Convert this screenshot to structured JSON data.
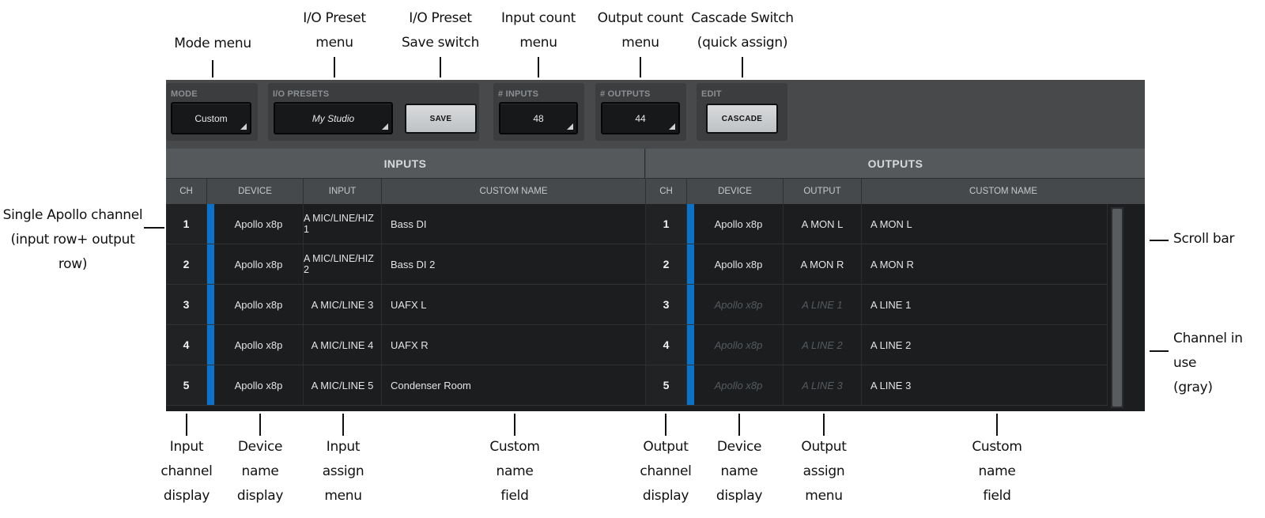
{
  "controls": {
    "mode": {
      "label": "MODE",
      "value": "Custom"
    },
    "io_presets": {
      "label": "I/O PRESETS",
      "value": "My Studio",
      "save_label": "SAVE"
    },
    "inputs": {
      "label": "# INPUTS",
      "value": "48"
    },
    "outputs": {
      "label": "# OUTPUTS",
      "value": "44"
    },
    "edit": {
      "label": "EDIT",
      "cascade_label": "CASCADE"
    }
  },
  "sections": {
    "inputs": "INPUTS",
    "outputs": "OUTPUTS"
  },
  "columns": {
    "inputs": [
      "CH",
      "DEVICE",
      "INPUT",
      "CUSTOM NAME"
    ],
    "outputs": [
      "CH",
      "DEVICE",
      "OUTPUT",
      "CUSTOM NAME"
    ]
  },
  "input_rows": [
    {
      "ch": "1",
      "device": "Apollo x8p",
      "input": "A MIC/LINE/HIZ 1",
      "name": "Bass DI"
    },
    {
      "ch": "2",
      "device": "Apollo x8p",
      "input": "A MIC/LINE/HIZ 2",
      "name": "Bass DI 2"
    },
    {
      "ch": "3",
      "device": "Apollo x8p",
      "input": "A MIC/LINE 3",
      "name": "UAFX L"
    },
    {
      "ch": "4",
      "device": "Apollo x8p",
      "input": "A MIC/LINE 4",
      "name": "UAFX R"
    },
    {
      "ch": "5",
      "device": "Apollo x8p",
      "input": "A MIC/LINE 5",
      "name": "Condenser Room"
    }
  ],
  "output_rows": [
    {
      "ch": "1",
      "device": "Apollo x8p",
      "output": "A MON L",
      "name": "A MON L",
      "in_use": false
    },
    {
      "ch": "2",
      "device": "Apollo x8p",
      "output": "A MON R",
      "name": "A MON R",
      "in_use": false
    },
    {
      "ch": "3",
      "device": "Apollo x8p",
      "output": "A LINE 1",
      "name": "A LINE 1",
      "in_use": true
    },
    {
      "ch": "4",
      "device": "Apollo x8p",
      "output": "A LINE 2",
      "name": "A LINE 2",
      "in_use": true
    },
    {
      "ch": "5",
      "device": "Apollo x8p",
      "output": "A LINE 3",
      "name": "A LINE 3",
      "in_use": true
    }
  ],
  "colors": {
    "accent_strip": "#0a72c9",
    "panel": "#47494b",
    "grid": "#1b1d1f"
  },
  "callouts": {
    "top": [
      "Mode menu",
      "I/O Preset\nmenu",
      "I/O Preset\nSave switch",
      "Input count\nmenu",
      "Output count\nmenu",
      "Cascade Switch\n(quick assign)"
    ],
    "left": "Single Apollo channel\n(input row+ output row)",
    "right": [
      "Scroll bar",
      "Channel in use\n(gray)"
    ],
    "bottom": [
      "Input\nchannel\ndisplay",
      "Device\nname\ndisplay",
      "Input\nassign\nmenu",
      "Custom\nname\nfield",
      "Output\nchannel\ndisplay",
      "Device\nname\ndisplay",
      "Output\nassign\nmenu",
      "Custom\nname\nfield"
    ]
  }
}
